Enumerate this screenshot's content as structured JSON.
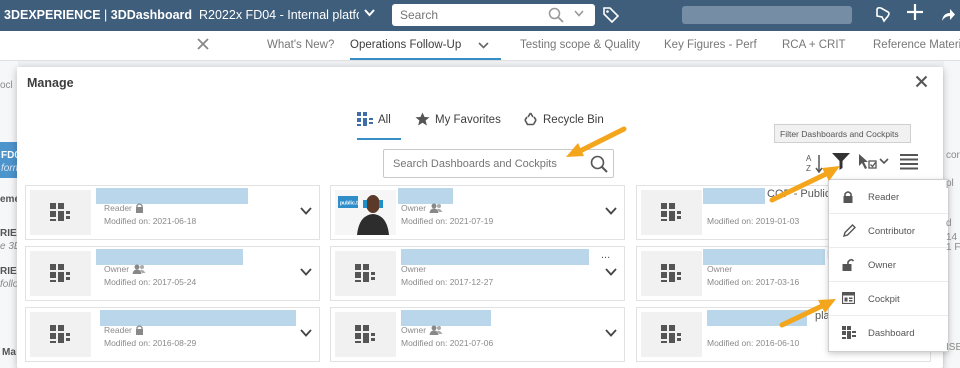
{
  "topbar": {
    "brand": "3DEXPERIENCE",
    "separator": " | ",
    "app": "3DDashboard",
    "context": "R2022x FD04 - Internal platfor...",
    "search_placeholder": "Search"
  },
  "tabs": [
    "What's New?",
    "Operations Follow-Up",
    "Testing scope & Quality",
    "Key Figures - Perf",
    "RCA + CRIT",
    "Reference Materia"
  ],
  "background": {
    "left_fragments": [
      "ocl",
      "FD04",
      "form",
      "eme",
      "RIE",
      "e 3D",
      "RIE",
      "follo",
      "Ma"
    ],
    "right_fragments": [
      "cor",
      "pl",
      "d",
      "14",
      "1 F",
      "ISE"
    ]
  },
  "modal": {
    "title": "Manage",
    "tabs": {
      "all": "All",
      "favorites": "My Favorites",
      "recycle": "Recycle Bin"
    },
    "search_placeholder": "Search Dashboards and Cockpits",
    "tooltip": "Filter Dashboards and Cockpits",
    "modified_prefix": "Modified on:",
    "cards": [
      {
        "role": "Reader",
        "date": "2021-06-18",
        "tail": ""
      },
      {
        "role": "Owner",
        "date": "2021-07-19",
        "tail": "",
        "avatar_caption": "public.tp"
      },
      {
        "role": "",
        "date": "2019-01-03",
        "tail": "COP - Public"
      },
      {
        "role": "Owner",
        "date": "2017-05-24",
        "tail": ""
      },
      {
        "role": "Owner",
        "date": "2017-12-27",
        "tail": "..."
      },
      {
        "role": "Owner",
        "date": "2017-03-16",
        "tail": "F"
      },
      {
        "role": "Reader",
        "date": "2016-08-29",
        "tail": ""
      },
      {
        "role": "Owner",
        "date": "2021-07-06",
        "tail": ""
      },
      {
        "role": "",
        "date": "2016-06-10",
        "tail": "plat"
      }
    ],
    "filter_menu": [
      "Reader",
      "Contributor",
      "Owner",
      "Cockpit",
      "Dashboard"
    ]
  },
  "colors": {
    "topbar": "#3f5e7c",
    "accent": "#368ec4",
    "arrow": "#f3a51c"
  }
}
